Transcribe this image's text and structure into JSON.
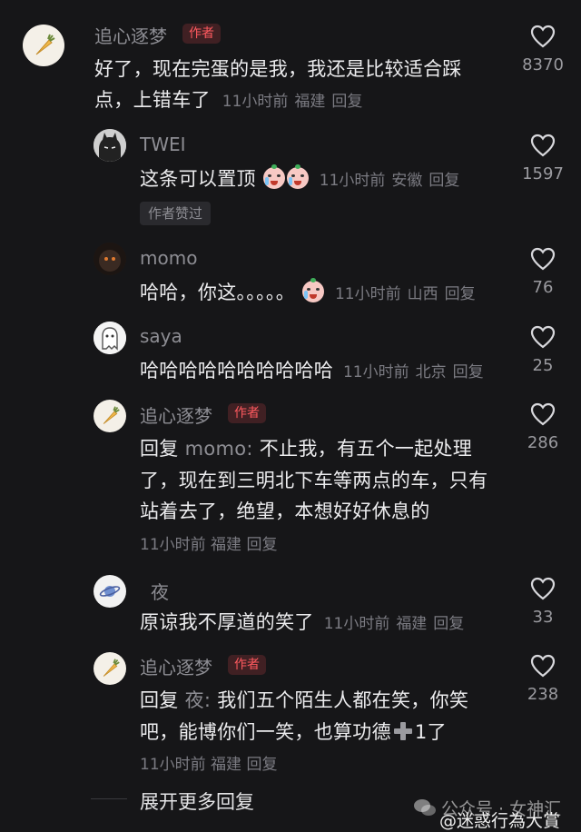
{
  "comments": [
    {
      "user": "追心逐梦",
      "badge": "作者",
      "lines": [
        "好了，现在完蛋的是我，我还是比较适合踩",
        "点，上错车了"
      ],
      "time": "11小时前",
      "location": "福建",
      "reply": "回复",
      "likes": "8370"
    },
    {
      "user": "TWEI",
      "text": "这条可以置顶",
      "time": "11小时前",
      "location": "安徽",
      "reply": "回复",
      "likes": "1597",
      "liked_by": "作者赞过"
    },
    {
      "user": "momo",
      "text": "哈哈，你这。。。。。",
      "time": "11小时前",
      "location": "山西",
      "reply": "回复",
      "likes": "76"
    },
    {
      "user": "saya",
      "text": "哈哈哈哈哈哈哈哈哈哈",
      "time": "11小时前",
      "location": "北京",
      "reply": "回复",
      "likes": "25"
    },
    {
      "user": "追心逐梦",
      "badge": "作者",
      "reply_prefix": "回复",
      "mention": "momo:",
      "lines": [
        "不止我，有五个一起处理",
        "了，现在到三明北下车等两点的车，只有",
        "站着去了，绝望，本想好好休息的"
      ],
      "time": "11小时前",
      "location": "福建",
      "reply": "回复",
      "likes": "286"
    },
    {
      "user": "夜",
      "text": "原谅我不厚道的笑了",
      "time": "11小时前",
      "location": "福建",
      "reply": "回复",
      "likes": "33"
    },
    {
      "user": "追心逐梦",
      "badge": "作者",
      "reply_prefix": "回复",
      "mention": "夜:",
      "lines": [
        "我们五个陌生人都在笑，你笑",
        "吧，能博你们一笑，也算功德",
        "1了"
      ],
      "time": "11小时前",
      "location": "福建",
      "reply": "回复",
      "likes": "238"
    }
  ],
  "expand_more": "展开更多回复",
  "watermark": "公众号 · 女神汇",
  "weibo_mark": "@迷惑行為大賞",
  "icons": {
    "like": "heart-outline-icon",
    "emoji": "crying-laugh-emoji-icon",
    "plus": "heavy-plus-icon",
    "carrot_avatar": "carrot-icon",
    "planet_avatar": "planet-icon"
  },
  "colors": {
    "background": "#161618",
    "author_badge": "#ff5a5f",
    "meta": "#7b7b82"
  }
}
